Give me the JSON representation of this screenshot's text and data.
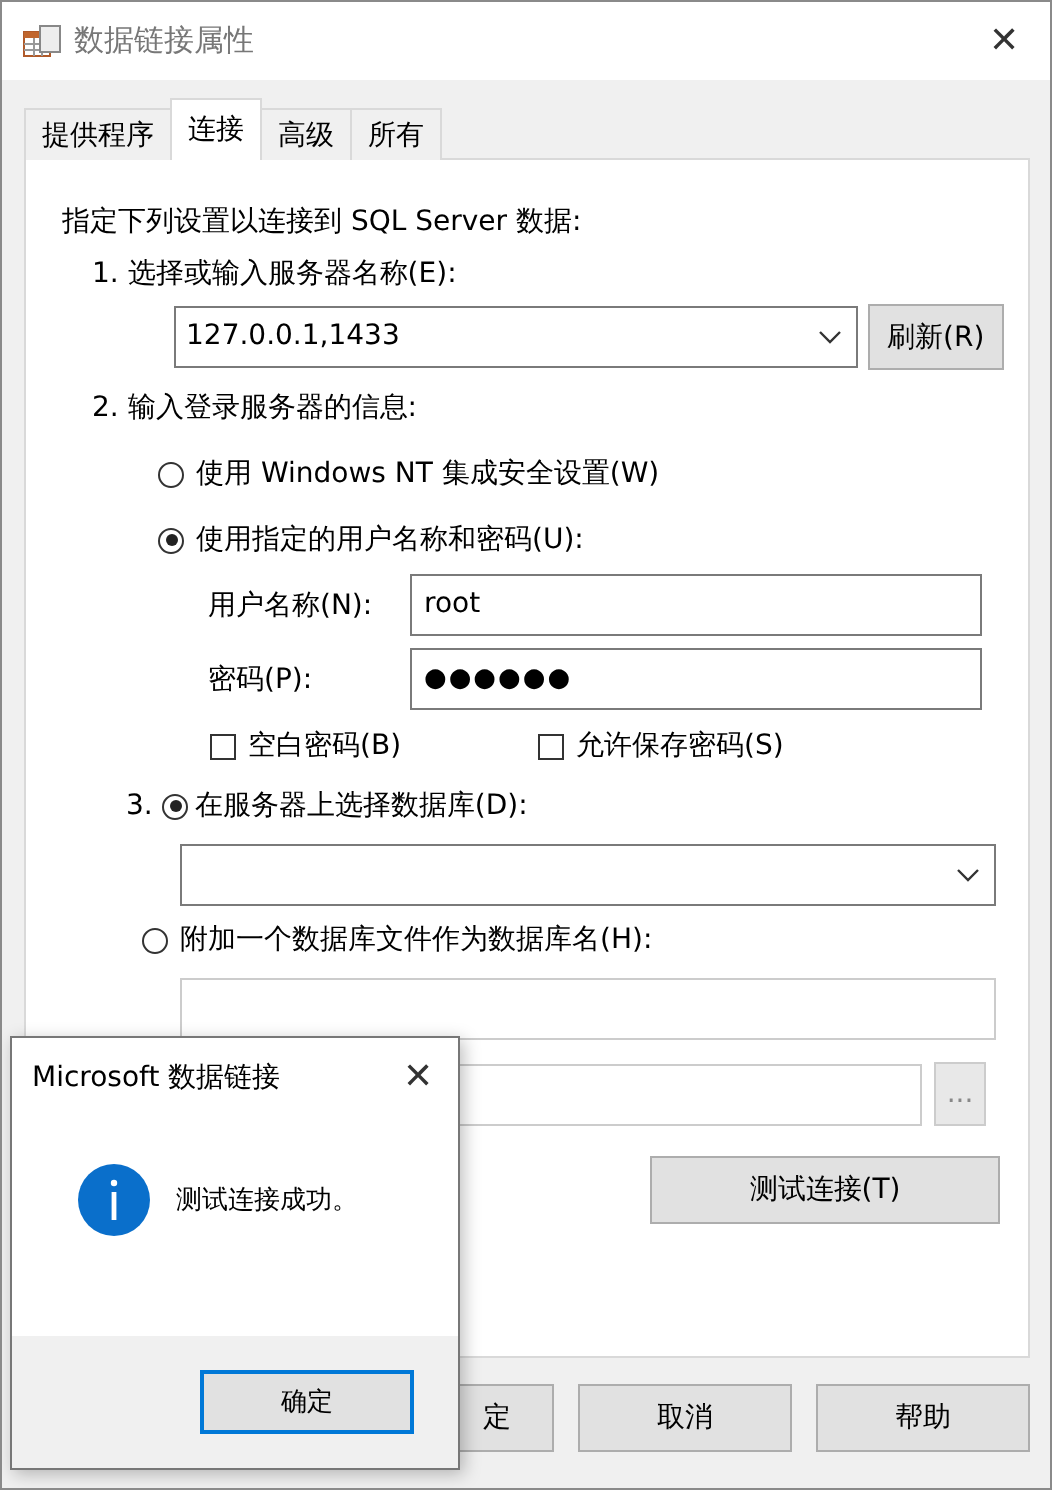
{
  "window": {
    "title": "数据链接属性",
    "close": "✕"
  },
  "tabs": [
    {
      "label": "提供程序",
      "selected": false
    },
    {
      "label": "连接",
      "selected": true
    },
    {
      "label": "高级",
      "selected": false
    },
    {
      "label": "所有",
      "selected": false
    }
  ],
  "connection": {
    "instruction": "指定下列设置以连接到 SQL Server 数据:",
    "step1": {
      "label": "1. 选择或输入服务器名称(E):",
      "server": "127.0.0.1,1433",
      "refresh_button": "刷新(R)"
    },
    "step2": {
      "label": "2. 输入登录服务器的信息:",
      "options": [
        {
          "label": "使用 Windows NT 集成安全设置(W)",
          "selected": false
        },
        {
          "label": "使用指定的用户名称和密码(U):",
          "selected": true
        }
      ],
      "username_label": "用户名称(N):",
      "username": "root",
      "password_label": "密码(P):",
      "password": "●●●●●●",
      "checkboxes": [
        {
          "label": "空白密码(B)",
          "checked": false
        },
        {
          "label": "允许保存密码(S)",
          "checked": false
        }
      ]
    },
    "step3": {
      "number": "3.",
      "options": [
        {
          "label": "在服务器上选择数据库(D):",
          "selected": true
        },
        {
          "label": "附加一个数据库文件作为数据库名(H):",
          "selected": false
        }
      ],
      "browse_button": "..."
    },
    "test_button": "测试连接(T)"
  },
  "buttons": [
    "定",
    "取消",
    "帮助"
  ],
  "message_box": {
    "title": "Microsoft 数据链接",
    "close": "✕",
    "message": "测试连接成功。",
    "ok_button": "确定"
  }
}
